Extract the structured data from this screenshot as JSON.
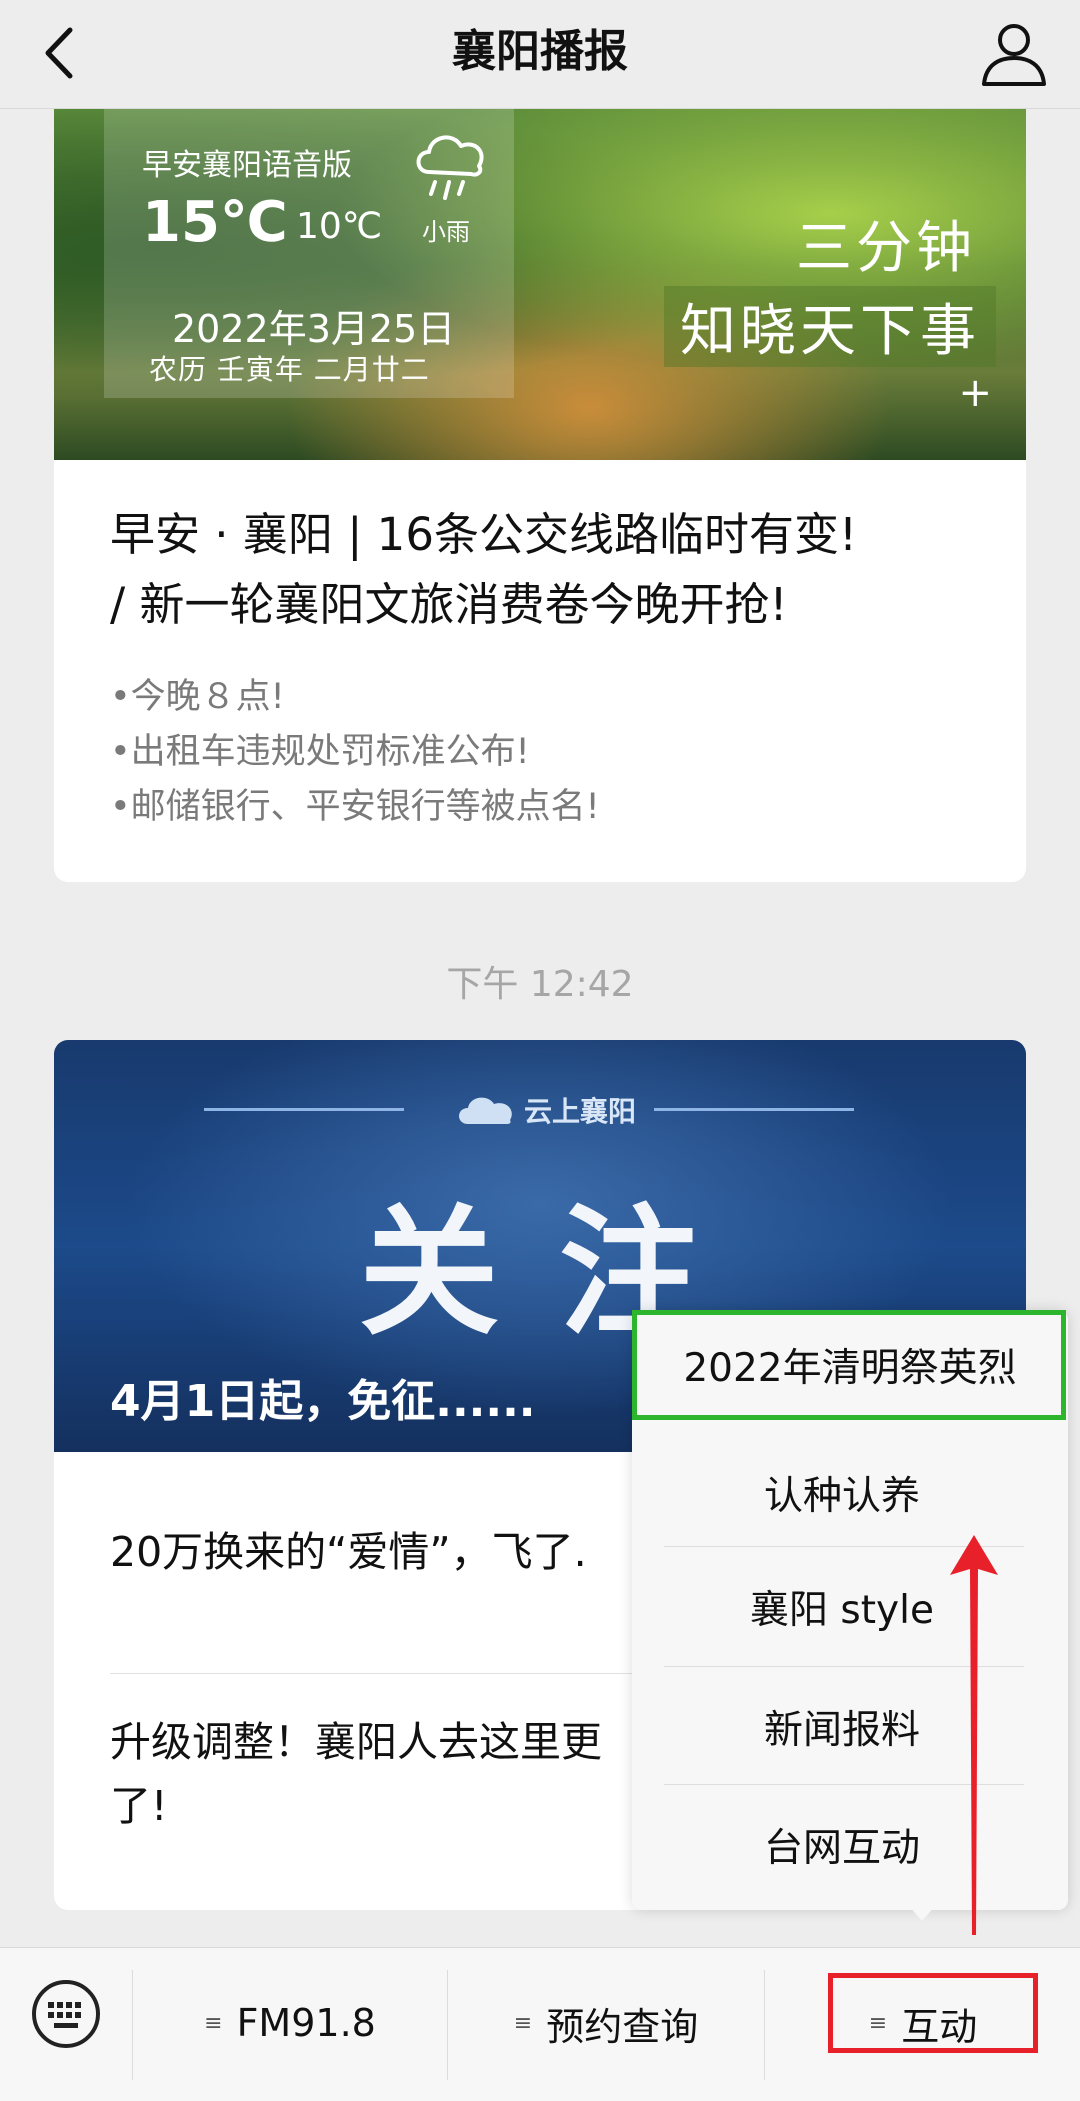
{
  "header": {
    "title": "襄阳播报"
  },
  "card1": {
    "banner": {
      "program": "早安襄阳语音版",
      "temp_high": "15℃",
      "temp_low": "10℃",
      "weather": "小雨",
      "date": "2022年3月25日",
      "lunar": "农历  壬寅年  二月廿二",
      "slogan_line1": "三分钟",
      "slogan_line2": "知晓天下事",
      "plus": "+"
    },
    "headline_line1": "早安 · 襄阳 |  16条公交线路临时有变!",
    "headline_line2": "/ 新一轮襄阳文旅消费卷今晚开抢!",
    "bullets": [
      "•今晚８点!",
      "•出租车违规处罚标准公布!",
      "•邮储银行、平安银行等被点名!"
    ]
  },
  "timestamp": "下午 12:42",
  "card2": {
    "banner_label": "云上襄阳",
    "banner_big": "关注",
    "banner_caption": "4月1日起，免征......",
    "items": [
      {
        "line1": "20万换来的“爱情”，飞了."
      },
      {
        "line1": "升级调整！襄阳人去这里更",
        "line2": "了!"
      }
    ]
  },
  "popup_menu": [
    "2022年清明祭英烈",
    "认种认养",
    "襄阳 style",
    "新闻报料",
    "台网互动"
  ],
  "bottom_tabs": [
    "FM91.8",
    "预约查询",
    "互动"
  ],
  "tab_glyph": "≡",
  "colors": {
    "highlight_green": "#2db52d",
    "highlight_red": "#e8202a"
  }
}
